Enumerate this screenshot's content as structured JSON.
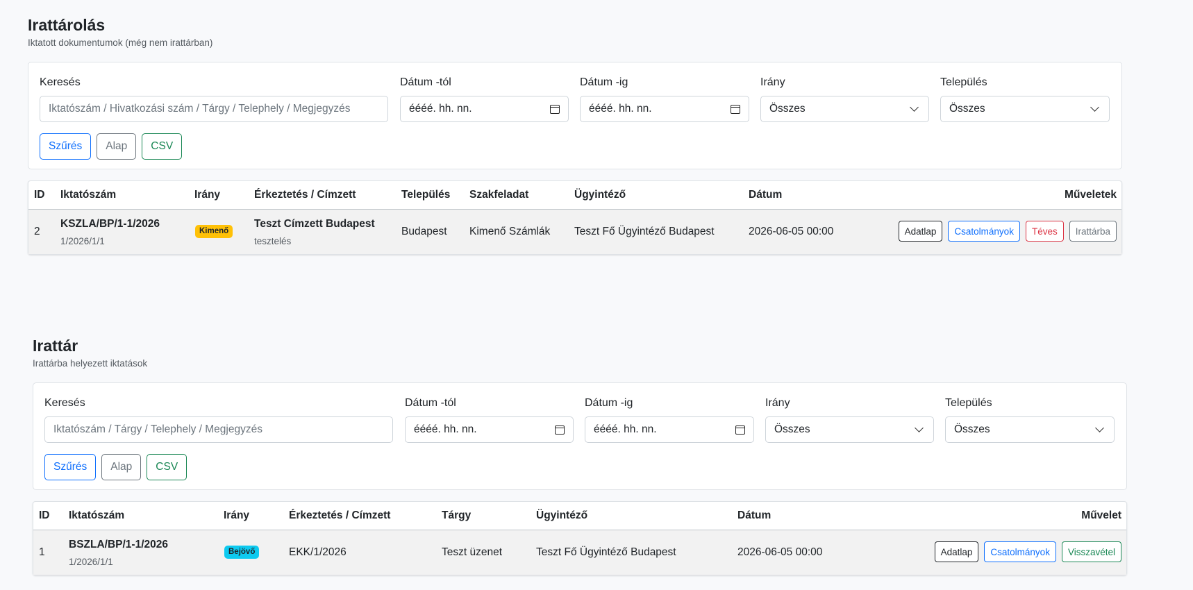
{
  "archiving": {
    "title": "Irattárolás",
    "subtitle": "Iktatott dokumentumok (még nem irattárban)",
    "filters": {
      "search_label": "Keresés",
      "search_placeholder": "Iktatószám / Hivatkozási szám / Tárgy / Telephely / Megjegyzés",
      "date_from_label": "Dátum -tól",
      "date_from_placeholder": "éééé. hh. nn.",
      "date_to_label": "Dátum -ig",
      "date_to_placeholder": "éééé. hh. nn.",
      "direction_label": "Irány",
      "direction_value": "Összes",
      "settlement_label": "Település",
      "settlement_value": "Összes",
      "filter_button": "Szűrés",
      "reset_button": "Alap",
      "csv_button": "CSV"
    },
    "table": {
      "headers": [
        "ID",
        "Iktatószám",
        "Irány",
        "Érkeztetés / Címzett",
        "Település",
        "Szakfeladat",
        "Ügyintéző",
        "Dátum",
        "Műveletek"
      ],
      "rows": [
        {
          "id": "2",
          "reg_number": "KSZLA/BP/1-1/2026",
          "reg_sub": "1/2026/1/1",
          "direction": "Kimenő",
          "recipient": "Teszt Címzett Budapest",
          "recipient_sub": "tesztelés",
          "settlement": "Budapest",
          "task": "Kimenő Számlák",
          "officer": "Teszt Fő Ügyintéző Budapest",
          "date": "2026-06-05 00:00",
          "actions": [
            "Adatlap",
            "Csatolmányok",
            "Téves",
            "Irattárba"
          ]
        }
      ]
    }
  },
  "archive": {
    "title": "Irattár",
    "subtitle": "Irattárba helyezett iktatások",
    "filters": {
      "search_label": "Keresés",
      "search_placeholder": "Iktatószám / Tárgy / Telephely / Megjegyzés",
      "date_from_label": "Dátum -tól",
      "date_from_placeholder": "éééé. hh. nn.",
      "date_to_label": "Dátum -ig",
      "date_to_placeholder": "éééé. hh. nn.",
      "direction_label": "Irány",
      "direction_value": "Összes",
      "settlement_label": "Település",
      "settlement_value": "Összes",
      "filter_button": "Szűrés",
      "reset_button": "Alap",
      "csv_button": "CSV"
    },
    "table": {
      "headers": [
        "ID",
        "Iktatószám",
        "Irány",
        "Érkeztetés / Címzett",
        "Tárgy",
        "Ügyintéző",
        "Dátum",
        "Művelet"
      ],
      "rows": [
        {
          "id": "1",
          "reg_number": "BSZLA/BP/1-1/2026",
          "reg_sub": "1/2026/1/1",
          "direction": "Bejövő",
          "received": "EKK/1/2026",
          "subject": "Teszt üzenet",
          "officer": "Teszt Fő Ügyintéző Budapest",
          "date": "2026-06-05 00:00",
          "actions": [
            "Adatlap",
            "Csatolmányok",
            "Visszavétel"
          ]
        }
      ]
    }
  },
  "colors": {
    "primary": "#0d6efd",
    "secondary": "#6c757d",
    "success": "#198754",
    "danger": "#dc3545",
    "warning_badge": "#ffc107",
    "info_badge": "#0dcaf0"
  },
  "icons": [
    "calendar-icon",
    "chevron-down-icon"
  ]
}
